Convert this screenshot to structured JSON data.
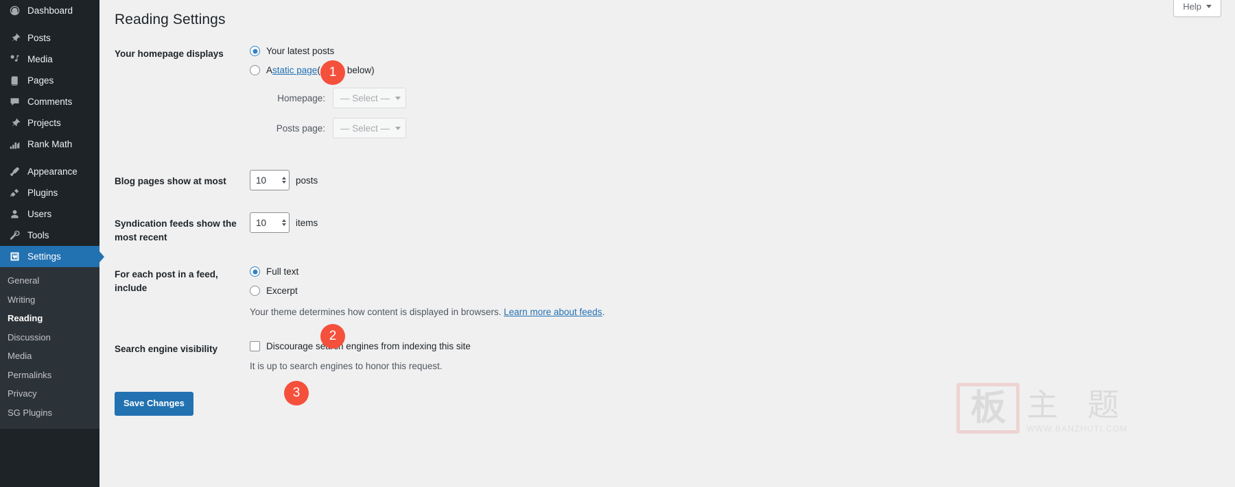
{
  "sidebar": {
    "items": [
      {
        "label": "Dashboard",
        "icon": "dashboard-icon",
        "sep_after": true
      },
      {
        "label": "Posts",
        "icon": "pin-icon",
        "sep_after": false
      },
      {
        "label": "Media",
        "icon": "media-icon",
        "sep_after": false
      },
      {
        "label": "Pages",
        "icon": "pages-icon",
        "sep_after": false
      },
      {
        "label": "Comments",
        "icon": "comments-icon",
        "sep_after": false
      },
      {
        "label": "Projects",
        "icon": "pin-icon",
        "sep_after": false
      },
      {
        "label": "Rank Math",
        "icon": "rankmath-icon",
        "sep_after": true
      },
      {
        "label": "Appearance",
        "icon": "appearance-icon",
        "sep_after": false
      },
      {
        "label": "Plugins",
        "icon": "plugins-icon",
        "sep_after": false
      },
      {
        "label": "Users",
        "icon": "users-icon",
        "sep_after": false
      },
      {
        "label": "Tools",
        "icon": "tools-icon",
        "sep_after": false
      },
      {
        "label": "Settings",
        "icon": "settings-icon",
        "sep_after": false,
        "active": true
      }
    ],
    "submenu": [
      {
        "label": "General"
      },
      {
        "label": "Writing"
      },
      {
        "label": "Reading",
        "current": true
      },
      {
        "label": "Discussion"
      },
      {
        "label": "Media"
      },
      {
        "label": "Permalinks"
      },
      {
        "label": "Privacy"
      },
      {
        "label": "SG Plugins"
      }
    ],
    "active_color": "#2271b1",
    "background": "#1d2327",
    "submenu_background": "#2c3338"
  },
  "header": {
    "help_label": "Help",
    "page_title": "Reading Settings"
  },
  "homepage_section": {
    "label": "Your homepage displays",
    "option_latest": "Your latest posts",
    "option_static_prefix": "A ",
    "option_static_link": "static page",
    "option_static_suffix": " (select below)",
    "selected": "latest",
    "homepage_label": "Homepage:",
    "homepage_value": "— Select —",
    "posts_page_label": "Posts page:",
    "posts_page_value": "— Select —"
  },
  "blog_pages": {
    "label": "Blog pages show at most",
    "value": "10",
    "unit": "posts"
  },
  "syndication": {
    "label": "Syndication feeds show the most recent",
    "value": "10",
    "unit": "items"
  },
  "feed_include": {
    "label": "For each post in a feed, include",
    "option_full": "Full text",
    "option_excerpt": "Excerpt",
    "selected": "full",
    "note_prefix": "Your theme determines how content is displayed in browsers. ",
    "note_link": "Learn more about feeds",
    "note_suffix": "."
  },
  "search_visibility": {
    "label": "Search engine visibility",
    "checkbox_label": "Discourage search engines from indexing this site",
    "checked": false,
    "note": "It is up to search engines to honor this request."
  },
  "actions": {
    "save_label": "Save Changes"
  },
  "annotations": {
    "badge1": "1",
    "badge2": "2",
    "badge3": "3",
    "badge_color": "#f4503c"
  },
  "watermark": {
    "seal": "板",
    "text": "主 题",
    "url": "WWW.BANZHUTI.COM"
  }
}
